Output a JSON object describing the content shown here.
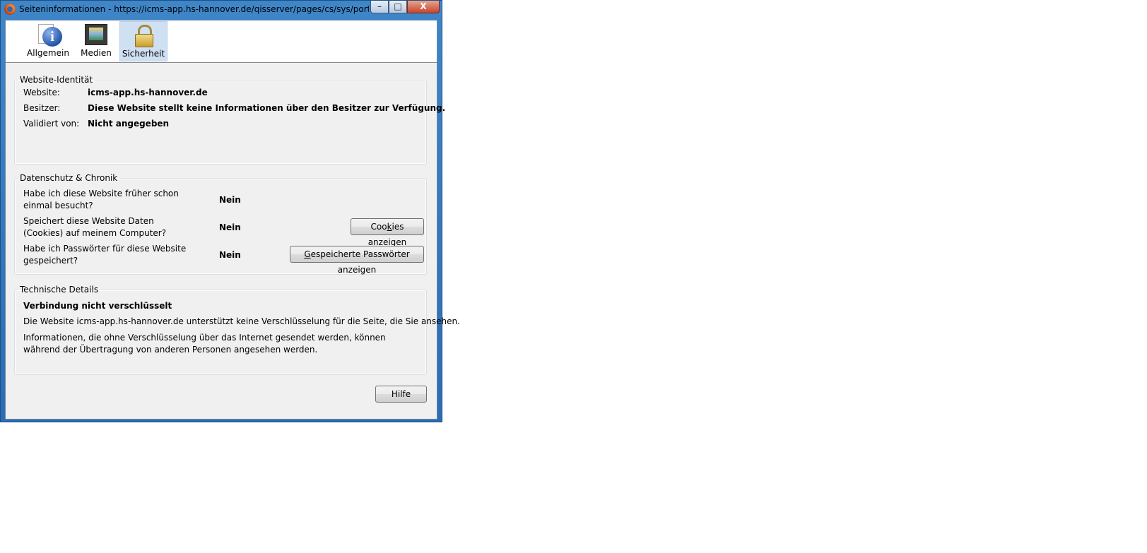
{
  "window": {
    "title": "Seiteninformationen - https://icms-app.hs-hannover.de/qisserver/pages/cs/sys/portal/hisi...",
    "controls": {
      "minimize": "–",
      "maximize": "□",
      "close": "X"
    }
  },
  "toolbar": {
    "items": [
      {
        "label": "Allgemein",
        "icon": "info-icon",
        "selected": false
      },
      {
        "label": "Medien",
        "icon": "media-icon",
        "selected": false
      },
      {
        "label": "Sicherheit",
        "icon": "lock-icon",
        "selected": true
      }
    ]
  },
  "identity": {
    "legend": "Website-Identität",
    "website_label": "Website:",
    "website_value": "icms-app.hs-hannover.de",
    "owner_label": "Besitzer:",
    "owner_value": "Diese Website stellt keine Informationen über den Besitzer zur Verfügung.",
    "verified_label": "Validiert von:",
    "verified_value": "Nicht angegeben"
  },
  "privacy": {
    "legend": "Datenschutz & Chronik",
    "rows": [
      {
        "question": "Habe ich diese Website früher schon einmal besucht?",
        "answer": "Nein"
      },
      {
        "question": "Speichert diese Website Daten (Cookies) auf meinem Computer?",
        "answer": "Nein"
      },
      {
        "question": "Habe ich Passwörter für diese Website gespeichert?",
        "answer": "Nein"
      }
    ],
    "cookies_button": {
      "pre": "Coo",
      "accel": "k",
      "post": "ies anzeigen"
    },
    "passwords_button": {
      "pre": "",
      "accel": "G",
      "post": "espeicherte Passwörter anzeigen"
    }
  },
  "tech": {
    "legend": "Technische Details",
    "headline": "Verbindung nicht verschlüsselt",
    "line1": "Die Website icms-app.hs-hannover.de unterstützt keine Verschlüsselung für die Seite, die Sie ansehen.",
    "line2": "Informationen, die ohne Verschlüsselung über das Internet gesendet werden, können während der Übertragung von anderen Personen angesehen werden."
  },
  "footer": {
    "help_label": "Hilfe"
  },
  "colors": {
    "titlebar": "#3f86c8",
    "selected_tab": "#cfe0f3",
    "dialog_bg": "#f0f0f0",
    "close_button": "#c8442b"
  }
}
